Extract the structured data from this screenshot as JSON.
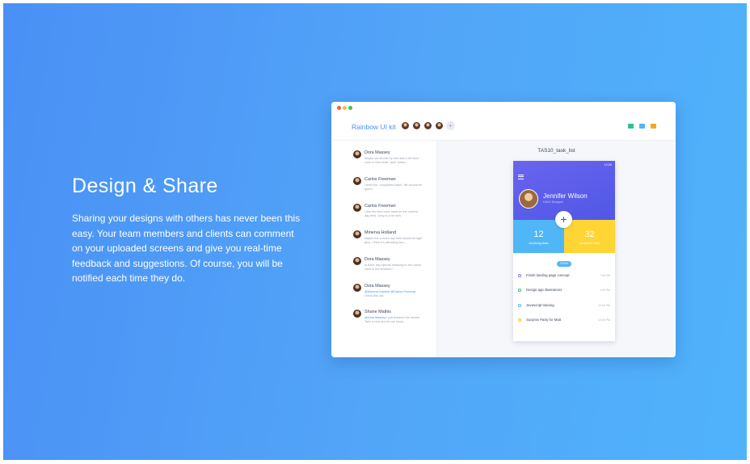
{
  "hero": {
    "title": "Design & Share",
    "body": "Sharing your designs with others has never been this easy. Your team members and clients can comment on your uploaded screens and give you real-time feedback and suggestions. Of course, you will be notified each time they do."
  },
  "window": {
    "app_title": "Rainbow UI kit",
    "add_member_glyph": "+",
    "header_icon_colors": [
      "#2ec28f",
      "#4fb6f7",
      "#f5a623"
    ]
  },
  "comments": [
    {
      "name": "Dora Massey",
      "text": "Maybe we should try and add a bit more color to that white \"add\" button."
    },
    {
      "name": "Carlos Freeman",
      "text": "I think the \"completed tasks\" tile should be green."
    },
    {
      "name": "Carlos Freeman",
      "text": "I like the blue color used for the current day field. Grey is a bit meh."
    },
    {
      "name": "Minerva Holland",
      "text": "Maybe the current day field should be light grey. I think it's attracting too..."
    },
    {
      "name": "Dora Massey",
      "text": "Is there any special meaning to the colors used in the timeline?"
    },
    {
      "name": "Dora Massey",
      "mention": "@Minerva Holland @Carlos Freeman",
      "text": "check this out."
    },
    {
      "name": "Shane Mathis",
      "mention": "@Dora Massey",
      "text": "I just finished the screen. Take a look and let me know..."
    }
  ],
  "canvas": {
    "screen_name": "TAS10_task_list"
  },
  "phone": {
    "status_time": "12:30",
    "user_name": "Jennifer Wilson",
    "user_role": "UI/UX Designer",
    "fab_glyph": "+",
    "stats": [
      {
        "value": "12",
        "label": "remaining tasks"
      },
      {
        "value": "32",
        "label": "completed tasks"
      }
    ],
    "day_pill": "TODAY",
    "tasks": [
      {
        "label": "Finish landing page concept",
        "time": "7:00 PM",
        "color": "#8b7cf6"
      },
      {
        "label": "Design app illustrations",
        "time": "1:00 PM",
        "color": "#2ec28f"
      },
      {
        "label": "Javascript training",
        "time": "12:00 PM",
        "color": "#4fb6f7"
      },
      {
        "label": "Surprise Party for Matt",
        "time": "10:30 PM",
        "color": "#f5c518"
      }
    ]
  }
}
